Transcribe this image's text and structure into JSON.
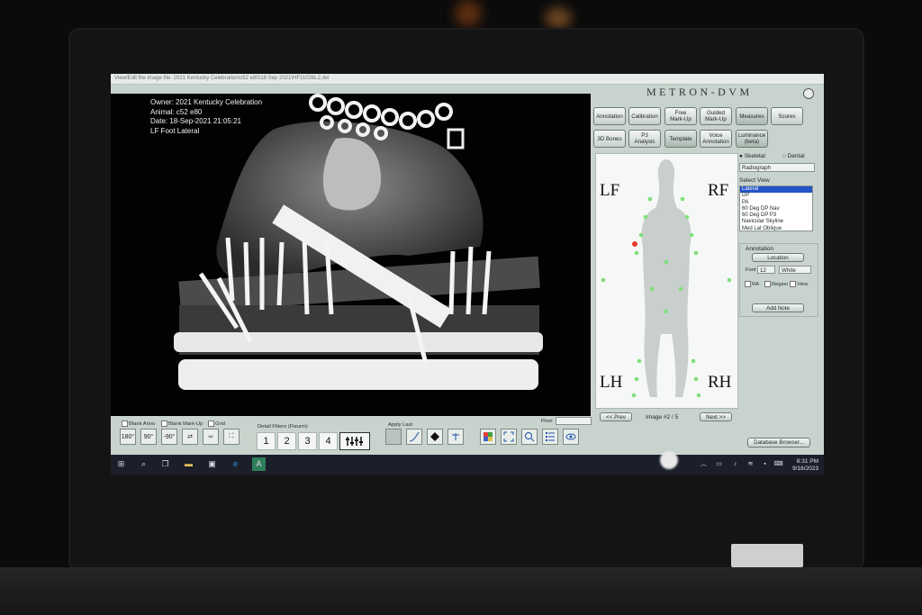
{
  "window": {
    "title": "View/Edit the image file: 2021 Kentucky Celebration\\c52 e80\\18 Sep 2021\\HF11026L2.dvi"
  },
  "brand": "METRON-DVM",
  "xray_info": {
    "owner": "Owner: 2021 Kentucky Celebration",
    "animal": "Animal: c52 e80",
    "date": "Date: 18-Sep-2021  21:05:21",
    "view": "LF Foot Lateral"
  },
  "top_buttons": [
    "Annotation",
    "Calibration",
    "Free\nMark-Up",
    "Guided\nMark-Up",
    "Measures",
    "Scores",
    "3D Bones",
    "P3\nAnalysis",
    "Template",
    "Voice\nAnnotation",
    "Luminance\n(beta)"
  ],
  "anatomy": {
    "lf": "LF",
    "rf": "RF",
    "lh": "LH",
    "rh": "RH"
  },
  "modality": {
    "skeletal": "Skeletal",
    "dental": "Dental",
    "selected": "Radiograph"
  },
  "select_view": {
    "label": "Select View",
    "items": [
      "Lateral",
      "DP",
      "PA",
      "60 Deg DP Nav",
      "60 Deg DP P3",
      "Navicular Skyline",
      "Med Lat Oblique"
    ]
  },
  "annotation_panel": {
    "label": "Annotation",
    "location_button": "Location",
    "font_label": "Font",
    "font_size": "12",
    "color": "White",
    "checks": [
      "RA",
      "Region",
      "View"
    ],
    "add_note": "Add Note"
  },
  "navigation": {
    "prev": "<< Prev",
    "image_count": "Image #2 / 5",
    "next": "Next >>"
  },
  "database_button": "Database Browser...",
  "bottom_checks": [
    "Blank Anno",
    "Blank Mark-Up",
    "Grid"
  ],
  "detail_filters": {
    "label": "Detail Filters (Fleurm)",
    "numbers": [
      "1",
      "2",
      "3",
      "4"
    ]
  },
  "apply_last": "Apply Last",
  "pixel_label": "Pixel",
  "tools_left": [
    "180°",
    "90°",
    "-90°",
    "⇄",
    "⬄",
    "⛶"
  ],
  "taskbar": {
    "time": "8:31 PM",
    "date": "9/16/2023"
  }
}
